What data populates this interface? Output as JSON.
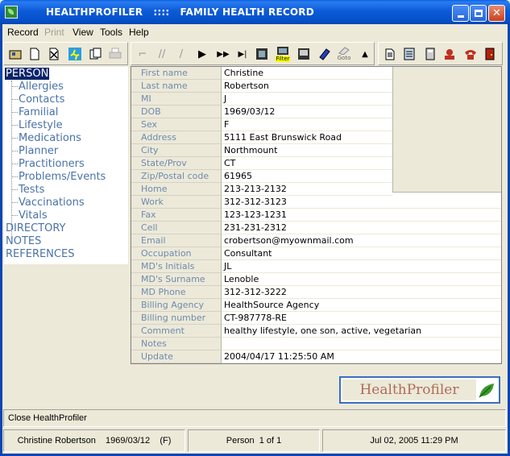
{
  "window": {
    "title": "HEALTHPROFILER   ::::   FAMILY HEALTH RECORD",
    "controls": [
      "minimize",
      "maximize",
      "close"
    ]
  },
  "menu": {
    "record": "Record",
    "print": "Print",
    "view": "View",
    "tools": "Tools",
    "help": "Help"
  },
  "toolbar": {
    "filter_label": "Filter",
    "goto_label": "Goto"
  },
  "tree": {
    "person": "PERSON",
    "children": [
      "Allergies",
      "Contacts",
      "Familial",
      "Lifestyle",
      "Medications",
      "Planner",
      "Practitioners",
      "Problems/Events",
      "Tests",
      "Vaccinations",
      "Vitals"
    ],
    "directory": "DIRECTORY",
    "notes": "NOTES",
    "references": "REFERENCES"
  },
  "record": {
    "fields": [
      {
        "label": "First name",
        "value": "Christine"
      },
      {
        "label": "Last name",
        "value": "Robertson"
      },
      {
        "label": "MI",
        "value": "J"
      },
      {
        "label": "DOB",
        "value": "1969/03/12"
      },
      {
        "label": "Sex",
        "value": "F"
      },
      {
        "label": "Address",
        "value": "5111 East Brunswick Road"
      },
      {
        "label": "City",
        "value": "Northmount"
      },
      {
        "label": "State/Prov",
        "value": "CT"
      },
      {
        "label": "Zip/Postal code",
        "value": "61965"
      },
      {
        "label": "Home",
        "value": "213-213-2132"
      },
      {
        "label": "Work",
        "value": "312-312-3123"
      },
      {
        "label": "Fax",
        "value": "123-123-1231"
      },
      {
        "label": "Cell",
        "value": "231-231-2312"
      },
      {
        "label": "Email",
        "value": "crobertson@myownmail.com"
      },
      {
        "label": "Occupation",
        "value": "Consultant"
      },
      {
        "label": "MD's Initials",
        "value": "JL"
      },
      {
        "label": "MD's Surname",
        "value": "Lenoble"
      },
      {
        "label": "MD Phone",
        "value": "312-312-3222"
      },
      {
        "label": "Billing Agency",
        "value": "HealthSource Agency"
      },
      {
        "label": "Billing number",
        "value": "CT-987778-RE"
      },
      {
        "label": "Comment",
        "value": "healthy lifestyle, one son, active, vegetarian"
      },
      {
        "label": "Notes",
        "value": ""
      },
      {
        "label": "Update",
        "value": "2004/04/17 11:25:50 AM"
      }
    ]
  },
  "logo": {
    "text": "HealthProfiler"
  },
  "status": {
    "message": "Close HealthProfiler",
    "person_info": "Christine Robertson    1969/03/12    (F)",
    "record_position": "Person  1 of 1",
    "datetime": "Jul 02, 2005 11:29 PM"
  },
  "colors": {
    "title_bar": "#0a5fe0",
    "tree_link": "#4a72a8",
    "field_label": "#6e8ab0",
    "selection": "#0a246a",
    "logo_text": "#b06b5a",
    "logo_border": "#3a6ec0"
  }
}
